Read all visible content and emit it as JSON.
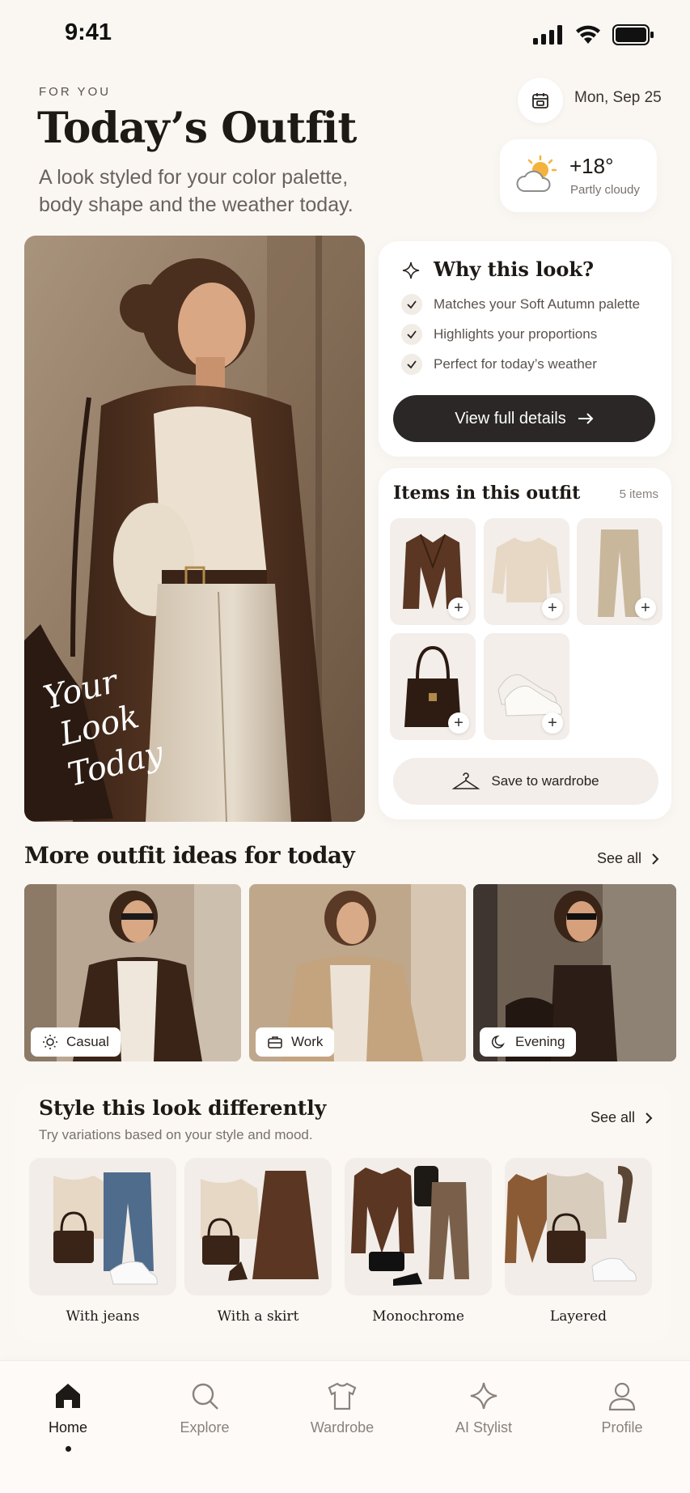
{
  "status_bar": {
    "time": "9:41"
  },
  "header": {
    "eyebrow": "FOR YOU",
    "title": "Today’s Outfit",
    "subtitle": "A look styled for your color palette, body shape and the weather today.",
    "date": "Mon, Sep 25"
  },
  "weather": {
    "temp": "+18°",
    "condition": "Partly cloudy",
    "icon": "partly-cloudy-icon"
  },
  "hero": {
    "overlay_text": [
      "Your",
      "Look",
      "Today"
    ]
  },
  "why": {
    "title": "Why this look?",
    "items": [
      "Matches your Soft Autumn palette",
      "Highlights your proportions",
      "Perfect for today’s weather"
    ],
    "button": "View full details"
  },
  "items_card": {
    "title": "Items in this outfit",
    "count": "5 items",
    "items": [
      "coat",
      "sweater",
      "trousers",
      "handbag",
      "sneakers"
    ],
    "save": "Save to wardrobe"
  },
  "more": {
    "title": "More outfit ideas for today",
    "see_all": "See all",
    "ideas": [
      {
        "label": "Casual",
        "icon": "sun-icon"
      },
      {
        "label": "Work",
        "icon": "briefcase-icon"
      },
      {
        "label": "Evening",
        "icon": "moon-icon"
      }
    ]
  },
  "style": {
    "title": "Style this look differently",
    "subtitle": "Try variations based on your style and mood.",
    "see_all": "See all",
    "variations": [
      "With jeans",
      "With a skirt",
      "Monochrome",
      "Layered"
    ]
  },
  "nav": [
    {
      "label": "Home",
      "icon": "home-icon",
      "active": true
    },
    {
      "label": "Explore",
      "icon": "search-icon"
    },
    {
      "label": "Wardrobe",
      "icon": "shirt-icon"
    },
    {
      "label": "AI Stylist",
      "icon": "sparkle-icon"
    },
    {
      "label": "Profile",
      "icon": "person-icon"
    }
  ],
  "colors": {
    "background": "#faf6f2",
    "dark": "#2a2726",
    "brown": "#5b3a26",
    "beige": "#e9ddd0"
  }
}
